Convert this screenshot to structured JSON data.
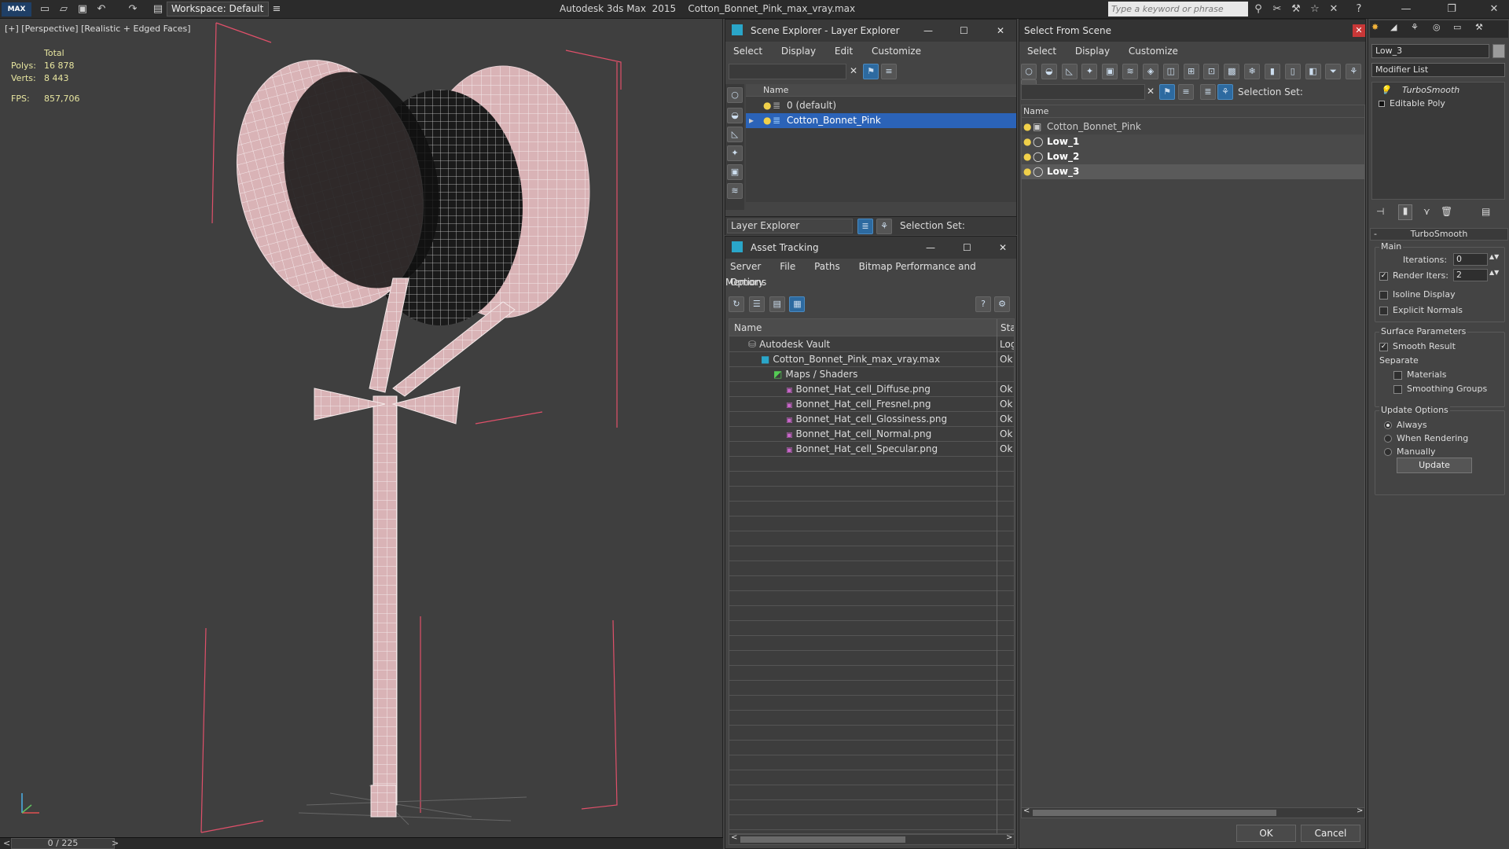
{
  "app": {
    "title": "Autodesk 3ds Max  2015    Cotton_Bonnet_Pink_max_vray.max",
    "logo": "MAX",
    "workspace": "Workspace: Default",
    "search_placeholder": "Type a keyword or phrase"
  },
  "viewport": {
    "label": "[+] [Perspective] [Realistic + Edged Faces]",
    "stats_header": "Total",
    "stats": [
      {
        "key": "Polys:",
        "value": "16 878"
      },
      {
        "key": "Verts:",
        "value": "8 443"
      },
      {
        "key": "FPS:",
        "value": "857,706"
      }
    ],
    "frame": "0 / 225"
  },
  "scene_explorer": {
    "title": "Scene Explorer - Layer Explorer",
    "menu": [
      "Select",
      "Display",
      "Edit",
      "Customize"
    ],
    "column": "Name",
    "rows": [
      {
        "name": "0 (default)",
        "selected": false
      },
      {
        "name": "Cotton_Bonnet_Pink",
        "selected": true
      }
    ],
    "footer_dropdown": "Layer Explorer",
    "footer_selection": "Selection Set:"
  },
  "asset_tracking": {
    "title": "Asset Tracking",
    "menu": [
      "Server",
      "File",
      "Paths",
      "Bitmap Performance and Memory"
    ],
    "menu2": "Options",
    "columns": [
      "Name",
      "Status"
    ],
    "rows": [
      {
        "name": "Autodesk Vault",
        "status": "Logged Out",
        "indent": 1
      },
      {
        "name": "Cotton_Bonnet_Pink_max_vray.max",
        "status": "Ok",
        "indent": 2
      },
      {
        "name": "Maps / Shaders",
        "status": "",
        "indent": 3
      },
      {
        "name": "Bonnet_Hat_cell_Diffuse.png",
        "status": "Ok",
        "indent": 4
      },
      {
        "name": "Bonnet_Hat_cell_Fresnel.png",
        "status": "Ok",
        "indent": 4
      },
      {
        "name": "Bonnet_Hat_cell_Glossiness.png",
        "status": "Ok",
        "indent": 4
      },
      {
        "name": "Bonnet_Hat_cell_Normal.png",
        "status": "Ok",
        "indent": 4
      },
      {
        "name": "Bonnet_Hat_cell_Specular.png",
        "status": "Ok",
        "indent": 4
      }
    ]
  },
  "select_from_scene": {
    "title": "Select From Scene",
    "menu": [
      "Select",
      "Display",
      "Customize"
    ],
    "selection_set": "Selection Set:",
    "column": "Name",
    "rows": [
      {
        "name": "Cotton_Bonnet_Pink",
        "bold": false
      },
      {
        "name": "Low_1",
        "bold": true
      },
      {
        "name": "Low_2",
        "bold": true
      },
      {
        "name": "Low_3",
        "bold": true
      }
    ],
    "ok": "OK",
    "cancel": "Cancel"
  },
  "command_panel": {
    "object_name": "Low_3",
    "modifier_list": "Modifier List",
    "stack": [
      "TurboSmooth",
      "Editable Poly"
    ],
    "rollout_title": "TurboSmooth",
    "main_label": "Main",
    "iterations_label": "Iterations:",
    "iterations_value": "0",
    "render_iters_label": "Render Iters:",
    "render_iters_value": "2",
    "isoline": "Isoline Display",
    "explicit_normals": "Explicit Normals",
    "surface_params": "Surface Parameters",
    "smooth_result": "Smooth Result",
    "separate": "Separate",
    "materials": "Materials",
    "smoothing_groups": "Smoothing Groups",
    "update_options": "Update Options",
    "always": "Always",
    "when_rendering": "When Rendering",
    "manually": "Manually",
    "update_button": "Update"
  }
}
